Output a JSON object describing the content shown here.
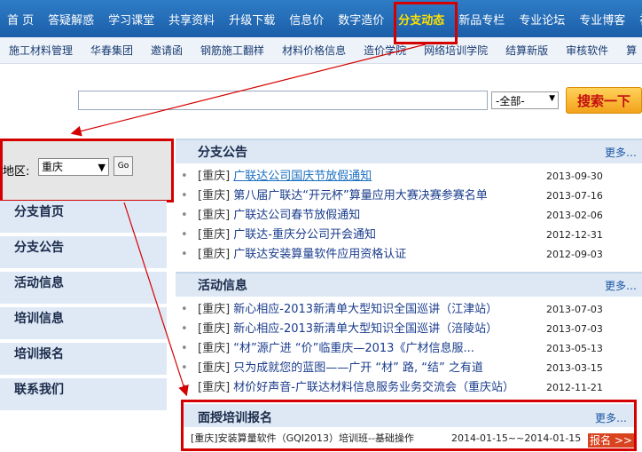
{
  "topnav": {
    "items": [
      "首 页",
      "答疑解惑",
      "学习课堂",
      "共享资料",
      "升级下载",
      "信息价",
      "数字造价",
      "分支动态",
      "新品专栏",
      "专业论坛",
      "专业博客",
      "视"
    ],
    "active_index": 7
  },
  "subnav": {
    "items": [
      "施工材料管理",
      "华春集团",
      "邀请函",
      "钢筋施工翻样",
      "材料价格信息",
      "造价学院",
      "网络培训学院",
      "结算新版",
      "审核软件",
      "算"
    ]
  },
  "search": {
    "input_value": "",
    "scope_value": "-全部-",
    "button_label": "搜索一下"
  },
  "region": {
    "label": "地区:",
    "selected": "重庆",
    "go_label": "Go"
  },
  "sidemenu": {
    "items": [
      "分支首页",
      "分支公告",
      "活动信息",
      "培训信息",
      "培训报名",
      "联系我们"
    ]
  },
  "announcements": {
    "title": "分支公告",
    "more": "更多…",
    "rows": [
      {
        "tag": "[重庆]",
        "title": "广联达公司国庆节放假通知",
        "date": "2013-09-30"
      },
      {
        "tag": "[重庆]",
        "title": "第八届广联达“开元杯”算量应用大赛决赛参赛名单",
        "date": "2013-07-16"
      },
      {
        "tag": "[重庆]",
        "title": "广联达公司春节放假通知",
        "date": "2013-02-06"
      },
      {
        "tag": "[重庆]",
        "title": "广联达-重庆分公司开会通知",
        "date": "2012-12-31"
      },
      {
        "tag": "[重庆]",
        "title": "广联达安装算量软件应用资格认证",
        "date": "2012-09-03"
      }
    ]
  },
  "activities": {
    "title": "活动信息",
    "more": "更多…",
    "rows": [
      {
        "tag": "[重庆]",
        "title": "新心相应-2013新清单大型知识全国巡讲（江津站）",
        "date": "2013-07-03"
      },
      {
        "tag": "[重庆]",
        "title": "新心相应-2013新清单大型知识全国巡讲（涪陵站）",
        "date": "2013-07-03"
      },
      {
        "tag": "[重庆]",
        "title": "“材”源广进 “价”临重庆—2013《广材信息服...",
        "date": "2013-05-13"
      },
      {
        "tag": "[重庆]",
        "title": "只为成就您的蓝图——广开 “材” 路, “结” 之有道",
        "date": "2013-03-15"
      },
      {
        "tag": "[重庆]",
        "title": "材价好声音-广联达材料信息服务业务交流会（重庆站）",
        "date": "2012-11-21"
      }
    ]
  },
  "training": {
    "title": "面授培训报名",
    "more": "更多…",
    "row_text": "[重庆]安装算量软件（GQI2013）培训班--基础操作",
    "dates": "2014-01-15~~2014-01-15",
    "signup_label": "报名 >>"
  },
  "colors": {
    "annotation_red": "#d40000",
    "nav_blue": "#1b5ea9",
    "active_yellow": "#ffe000"
  }
}
